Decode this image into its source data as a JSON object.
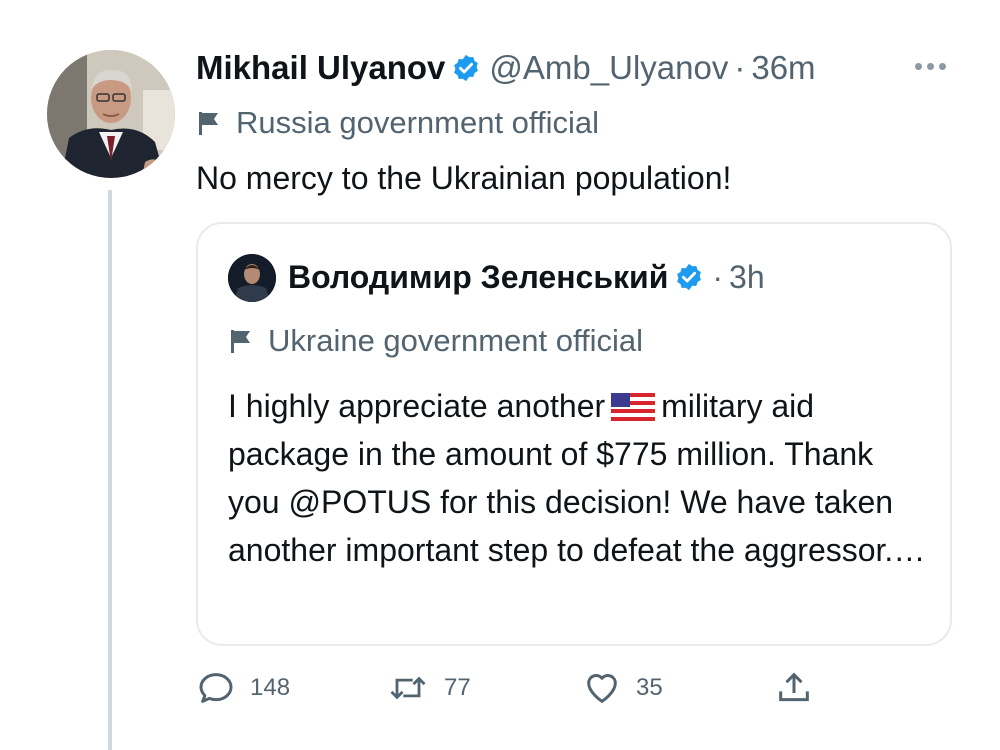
{
  "tweet": {
    "author_name": "Mikhail Ulyanov",
    "handle": "@Amb_Ulyanov",
    "separator": "·",
    "time": "36m",
    "affiliation": "Russia government official",
    "text": "No mercy to the Ukrainian population!"
  },
  "quoted": {
    "author_name": "Володимир Зеленський",
    "separator": "·",
    "time": "3h",
    "affiliation": "Ukraine government official",
    "text_before_flag": "I highly appreciate another",
    "text_after_flag": "military aid package in the amount of $775 million. Thank you @POTUS for this decision! We have taken another important step to defeat the aggressor.…"
  },
  "actions": {
    "replies": "148",
    "retweets": "77",
    "likes": "35"
  },
  "icons": {
    "verified": "verified-badge-icon",
    "affiliation": "flag-icon",
    "emoji": "us-flag-emoji",
    "reply": "reply-icon",
    "retweet": "retweet-icon",
    "like": "heart-icon",
    "share": "share-icon",
    "more": "more-icon"
  },
  "colors": {
    "verified": "#1d9bf0",
    "secondary_text": "#536471",
    "border": "#e7ebee"
  }
}
